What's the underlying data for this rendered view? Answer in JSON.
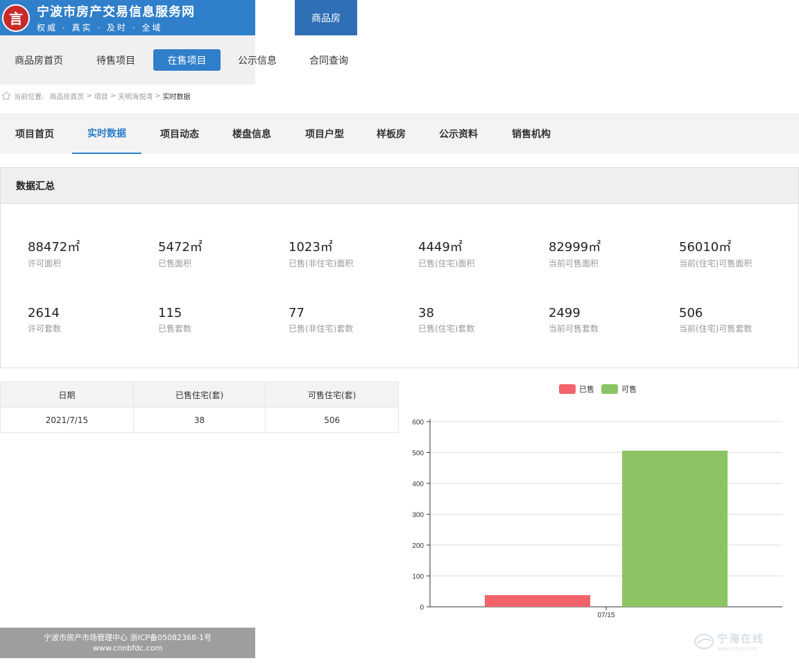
{
  "header": {
    "logo_glyph": "言",
    "site_title": "宁波市房产交易信息服务网",
    "site_slogan": "权威 · 真实 · 及时 · 全域",
    "channel_tab": "商品房",
    "brand_color": "#2f7fca"
  },
  "top_nav": {
    "items": [
      {
        "label": "商品房首页",
        "active": false
      },
      {
        "label": "待售项目",
        "active": false
      },
      {
        "label": "在售项目",
        "active": true
      },
      {
        "label": "公示信息",
        "active": false
      },
      {
        "label": "合同查询",
        "active": false
      }
    ]
  },
  "breadcrumb": {
    "prefix": "当前位置:",
    "items": [
      "商品房首页",
      "项目",
      "天明海悦湾",
      "实时数据"
    ],
    "separator": ">"
  },
  "project_tabs": {
    "items": [
      {
        "label": "项目首页",
        "active": false
      },
      {
        "label": "实时数据",
        "active": true
      },
      {
        "label": "项目动态",
        "active": false
      },
      {
        "label": "楼盘信息",
        "active": false
      },
      {
        "label": "项目户型",
        "active": false
      },
      {
        "label": "样板房",
        "active": false
      },
      {
        "label": "公示资料",
        "active": false
      },
      {
        "label": "销售机构",
        "active": false
      }
    ]
  },
  "summary": {
    "title": "数据汇总",
    "stats": [
      {
        "value": "88472㎡",
        "label": "许可面积"
      },
      {
        "value": "5472㎡",
        "label": "已售面积"
      },
      {
        "value": "1023㎡",
        "label": "已售(非住宅)面积"
      },
      {
        "value": "4449㎡",
        "label": "已售(住宅)面积"
      },
      {
        "value": "82999㎡",
        "label": "当前可售面积"
      },
      {
        "value": "56010㎡",
        "label": "当前(住宅)可售面积"
      },
      {
        "value": "2614",
        "label": "许可套数"
      },
      {
        "value": "115",
        "label": "已售套数"
      },
      {
        "value": "77",
        "label": "已售(非住宅)套数"
      },
      {
        "value": "38",
        "label": "已售(住宅)套数"
      },
      {
        "value": "2499",
        "label": "当前可售套数"
      },
      {
        "value": "506",
        "label": "当前(住宅)可售套数"
      }
    ]
  },
  "table": {
    "headers": [
      "日期",
      "已售住宅(套)",
      "可售住宅(套)"
    ],
    "rows": [
      [
        "2021/7/15",
        "38",
        "506"
      ]
    ]
  },
  "chart_data": {
    "type": "bar",
    "categories": [
      "07/15"
    ],
    "series": [
      {
        "name": "已售",
        "values": [
          38
        ],
        "color": "#f2646a"
      },
      {
        "name": "可售",
        "values": [
          506
        ],
        "color": "#8cc463"
      }
    ],
    "ylim": [
      0,
      600
    ],
    "yticks": [
      0,
      100,
      200,
      300,
      400,
      500,
      600
    ],
    "grid": true,
    "legend_position": "top-center"
  },
  "footer": {
    "line1": "宁波市房产市场管理中心 浙ICP备05082368-1号",
    "line2": "www.cnnbfdc.com"
  },
  "watermark": {
    "name": "宁海在线",
    "url": "www.nhzj.com"
  }
}
